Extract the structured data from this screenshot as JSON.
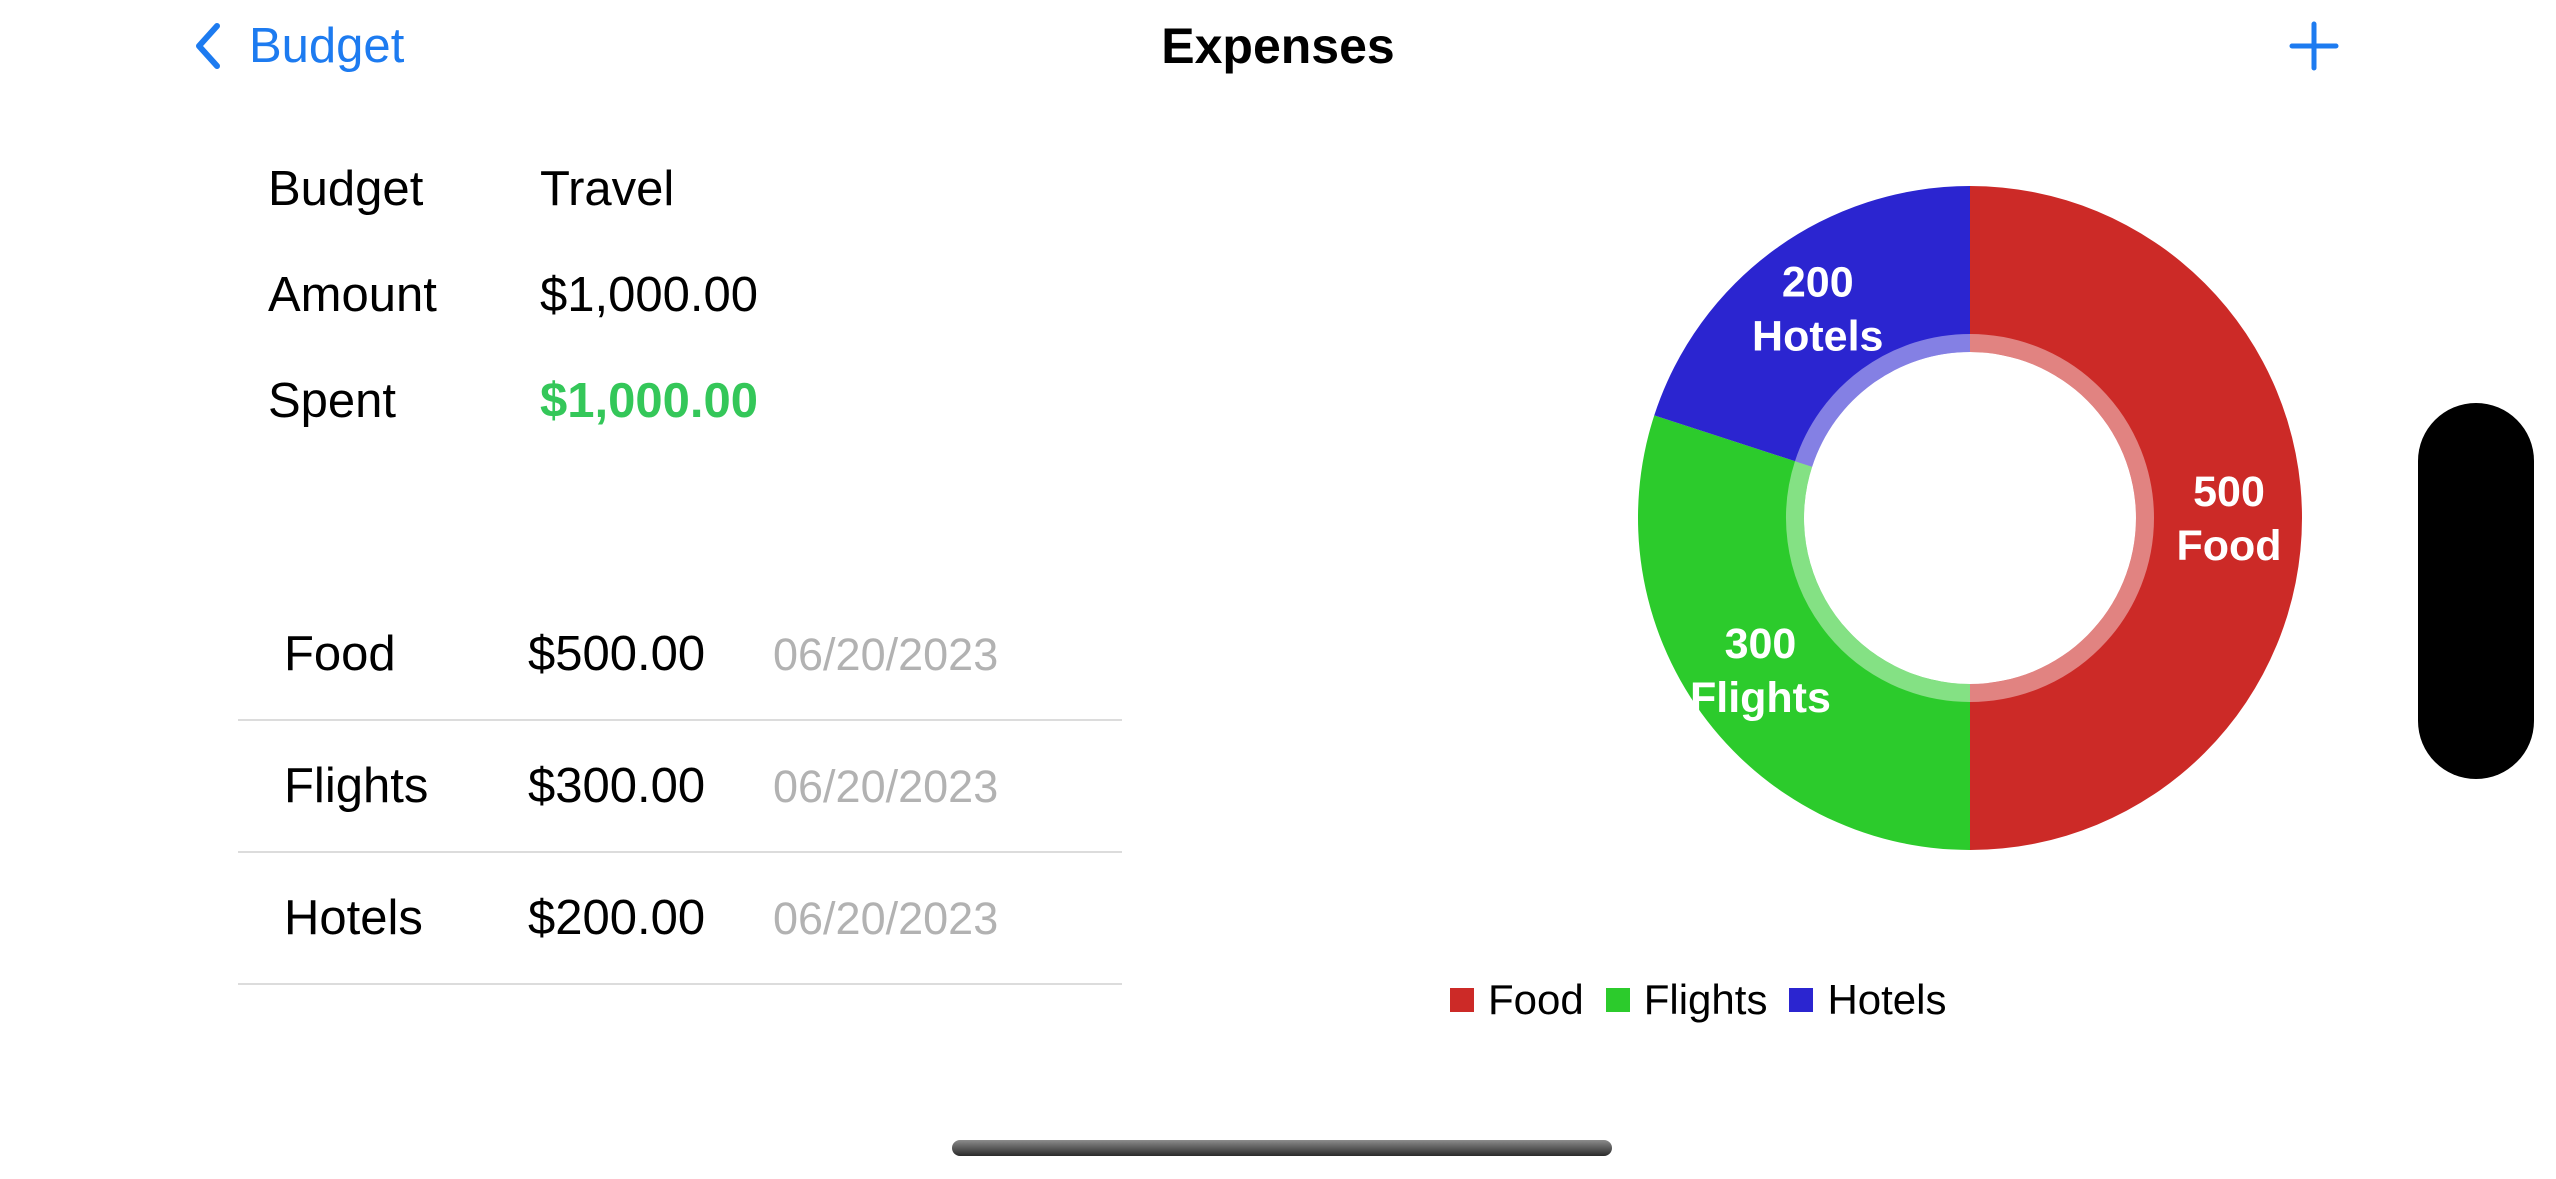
{
  "nav": {
    "back_label": "Budget",
    "title": "Expenses",
    "add_icon": "plus-icon",
    "back_icon": "chevron-left-icon"
  },
  "details": {
    "budget_label": "Budget",
    "budget_value": "Travel",
    "amount_label": "Amount",
    "amount_value": "$1,000.00",
    "spent_label": "Spent",
    "spent_value": "$1,000.00"
  },
  "expenses": [
    {
      "name": "Food",
      "amount": "$500.00",
      "date": "06/20/2023"
    },
    {
      "name": "Flights",
      "amount": "$300.00",
      "date": "06/20/2023"
    },
    {
      "name": "Hotels",
      "amount": "$200.00",
      "date": "06/20/2023"
    }
  ],
  "colors": {
    "accent": "#1d7bf0",
    "spent": "#34c759",
    "food": "#cc2a27",
    "flights": "#2ccb2c",
    "hotels": "#2b25d0"
  },
  "chart_data": {
    "type": "pie",
    "variant": "donut",
    "categories": [
      "Food",
      "Flights",
      "Hotels"
    ],
    "values": [
      500,
      300,
      200
    ],
    "data_labels": [
      {
        "value": "500",
        "category": "Food"
      },
      {
        "value": "300",
        "category": "Flights"
      },
      {
        "value": "200",
        "category": "Hotels"
      }
    ],
    "colors": [
      "#cc2a27",
      "#2ccb2c",
      "#2b25d0"
    ],
    "legend": [
      "Food",
      "Flights",
      "Hotels"
    ],
    "legend_position": "bottom"
  }
}
